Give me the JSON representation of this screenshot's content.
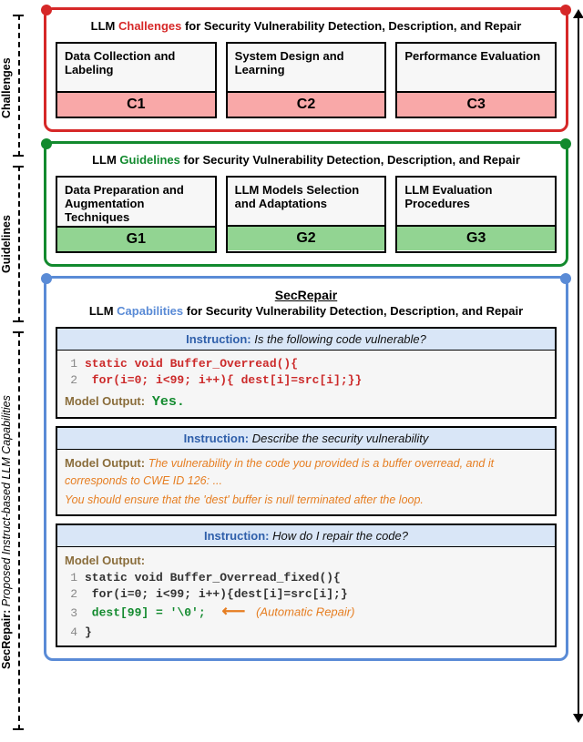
{
  "sidebar": {
    "challenges": "Challenges",
    "guidelines": "Guidelines",
    "secrepair_bold": "SecRepair:",
    "secrepair_rest": " Proposed Instruct-based LLM Capabilities"
  },
  "challenges": {
    "title_pre": "LLM ",
    "title_hl": "Challenges",
    "title_post": " for Security Vulnerability Detection, Description, and Repair",
    "cards": [
      {
        "text": "Data Collection and Labeling",
        "tag": "C1"
      },
      {
        "text": "System Design and Learning",
        "tag": "C2"
      },
      {
        "text": "Performance Evaluation",
        "tag": "C3"
      }
    ]
  },
  "guidelines": {
    "title_pre": "LLM ",
    "title_hl": "Guidelines",
    "title_post": " for Security Vulnerability Detection, Description, and Repair",
    "cards": [
      {
        "text": "Data Preparation and Augmentation Techniques",
        "tag": "G1"
      },
      {
        "text": "LLM Models Selection and Adaptations",
        "tag": "G2"
      },
      {
        "text": "LLM Evaluation Procedures",
        "tag": "G3"
      }
    ]
  },
  "capabilities": {
    "head": "SecRepair",
    "title_pre": "LLM ",
    "title_hl": "Capabilities",
    "title_post": " for Security Vulnerability Detection, Description, and Repair",
    "panels": {
      "detect": {
        "instruction_label": "Instruction:",
        "instruction_q": "Is the following code vulnerable?",
        "code": [
          {
            "n": "1",
            "text": "static void Buffer_Overread(){"
          },
          {
            "n": "2",
            "text": "   for(i=0; i<99; i++){ dest[i]=src[i];}}"
          }
        ],
        "model_out_label": "Model Output:",
        "model_out_val": "Yes."
      },
      "describe": {
        "instruction_label": "Instruction:",
        "instruction_q": "Describe the security vulnerability",
        "model_out_label": "Model Output:",
        "desc_line1": "The vulnerability in the code you provided is a buffer overread, and it corresponds to CWE ID 126: ...",
        "desc_line2": "You should ensure that the 'dest' buffer is null terminated after the loop."
      },
      "repair": {
        "instruction_label": "Instruction:",
        "instruction_q": "How do I repair the code?",
        "model_out_label": "Model Output:",
        "code": [
          {
            "n": "1",
            "text": "static void Buffer_Overread_fixed(){"
          },
          {
            "n": "2",
            "text": "  for(i=0; i<99; i++){dest[i]=src[i];}"
          },
          {
            "n": "3",
            "text": "  dest[99] = '\\0';"
          },
          {
            "n": "4",
            "text": "}"
          }
        ],
        "repair_note": "(Automatic Repair)"
      }
    }
  }
}
